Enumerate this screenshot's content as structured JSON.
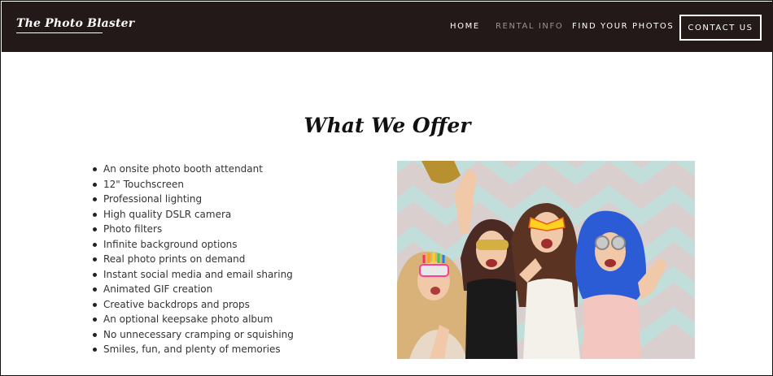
{
  "site": {
    "logo_text": "The Photo Blaster"
  },
  "nav": {
    "items": [
      {
        "label": "HOME"
      },
      {
        "label": "RENTAL INFO",
        "active": true
      },
      {
        "label": "FIND YOUR PHOTOS"
      }
    ],
    "cta_label": "CONTACT US"
  },
  "main": {
    "heading": "What We Offer",
    "features": [
      "An onsite photo booth attendant",
      "12\" Touchscreen",
      "Professional lighting",
      "High quality DSLR camera",
      "Photo filters",
      "Infinite background options",
      "Real photo prints on demand",
      "Instant social media and email sharing",
      "Animated GIF creation",
      "Creative backdrops and props",
      "An optional keepsake photo album",
      "No unnecessary cramping or squishing",
      "Smiles, fun, and plenty of memories"
    ]
  },
  "colors": {
    "header_bg": "#231919",
    "nav_text": "#ffffff",
    "nav_active": "#9a9191",
    "page_bg": "#ffffff",
    "body_text": "#333333"
  }
}
